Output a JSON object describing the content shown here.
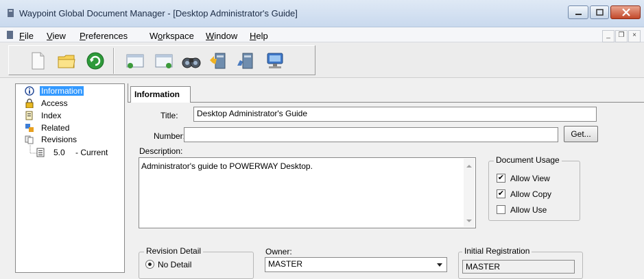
{
  "window": {
    "title": "Waypoint Global Document Manager - [Desktop Administrator's Guide]"
  },
  "menu": {
    "items": [
      {
        "pre": "",
        "key": "F",
        "post": "ile"
      },
      {
        "pre": "",
        "key": "V",
        "post": "iew"
      },
      {
        "pre": "",
        "key": "P",
        "post": "references"
      },
      {
        "pre": "W",
        "key": "o",
        "post": "rkspace"
      },
      {
        "pre": "",
        "key": "W",
        "post": "indow"
      },
      {
        "pre": "",
        "key": "H",
        "post": "elp"
      }
    ],
    "mdi": {
      "minimize": "_",
      "restore": "❐",
      "close": "×"
    }
  },
  "toolbar": {
    "icons": [
      "new-document-icon",
      "open-folder-icon",
      "refresh-icon",
      "checkout-icon",
      "checkin-icon",
      "search-binoculars-icon",
      "import-icon",
      "export-icon",
      "network-icon"
    ]
  },
  "tree": {
    "items": [
      {
        "label": "Information",
        "selected": true
      },
      {
        "label": "Access"
      },
      {
        "label": "Index"
      },
      {
        "label": "Related"
      },
      {
        "label": "Revisions"
      }
    ],
    "revision": {
      "number": "5.0",
      "status": "- Current"
    }
  },
  "tab": {
    "label": "Information"
  },
  "form": {
    "title_label": "Title:",
    "title_value": "Desktop Administrator's Guide",
    "number_label": "Number:",
    "number_value": "",
    "get_label": "Get...",
    "description_label": "Description:",
    "description_value": "Administrator's guide to POWERWAY Desktop.",
    "usage": {
      "legend": "Document Usage",
      "allow_view": {
        "label": "Allow View",
        "checked": true
      },
      "allow_copy": {
        "label": "Allow Copy",
        "checked": true
      },
      "allow_use": {
        "label": "Allow Use",
        "checked": false
      }
    },
    "revision_detail": {
      "legend": "Revision Detail",
      "option": "No Detail"
    },
    "owner": {
      "label": "Owner:",
      "value": "MASTER"
    },
    "initial_registration": {
      "legend": "Initial Registration",
      "value": "MASTER"
    }
  }
}
